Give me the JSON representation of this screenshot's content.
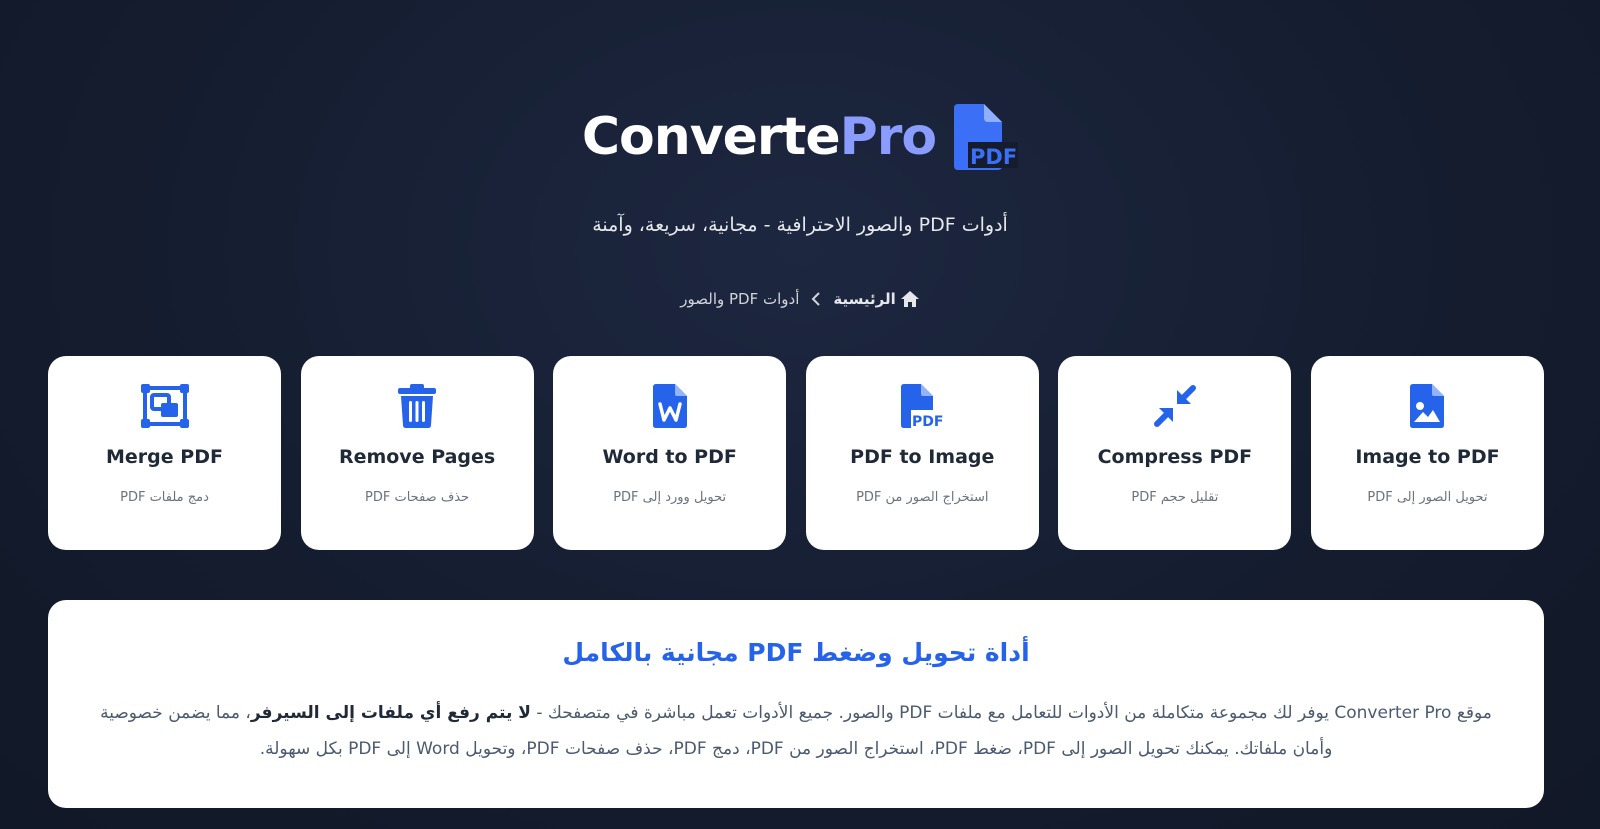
{
  "header": {
    "logo_part1": "Converte",
    "logo_part2": "Pro",
    "logo_icon_text": "PDF",
    "tagline": "أدوات PDF والصور الاحترافية - مجانية، سريعة، وآمنة"
  },
  "breadcrumb": {
    "home": "الرئيسية",
    "current": "أدوات PDF والصور"
  },
  "tools": [
    {
      "title": "Image to PDF",
      "subtitle": "تحويل الصور إلى PDF",
      "icon": "image-file-icon"
    },
    {
      "title": "Compress PDF",
      "subtitle": "تقليل حجم PDF",
      "icon": "compress-icon"
    },
    {
      "title": "PDF to Image",
      "subtitle": "استخراج الصور من PDF",
      "icon": "pdf-file-icon"
    },
    {
      "title": "Word to PDF",
      "subtitle": "تحويل وورد إلى PDF",
      "icon": "word-file-icon"
    },
    {
      "title": "Remove Pages",
      "subtitle": "حذف صفحات PDF",
      "icon": "trash-icon"
    },
    {
      "title": "Merge PDF",
      "subtitle": "دمج ملفات PDF",
      "icon": "merge-icon"
    }
  ],
  "info": {
    "heading": "أداة تحويل وضغط PDF مجانية بالكامل",
    "text_part1": "موقع Converter Pro يوفر لك مجموعة متكاملة من الأدوات للتعامل مع ملفات PDF والصور. جميع الأدوات تعمل مباشرة في متصفحك - ",
    "text_bold": "لا يتم رفع أي ملفات إلى السيرفر",
    "text_part2": "، مما يضمن خصوصية وأمان ملفاتك. يمكنك تحويل الصور إلى PDF، ضغط PDF، استخراج الصور من PDF، دمج PDF، حذف صفحات PDF، وتحويل Word إلى PDF بكل سهولة."
  },
  "colors": {
    "accent": "#2563eb",
    "logo_accent": "#8b9cff",
    "background": "#141c2e"
  }
}
